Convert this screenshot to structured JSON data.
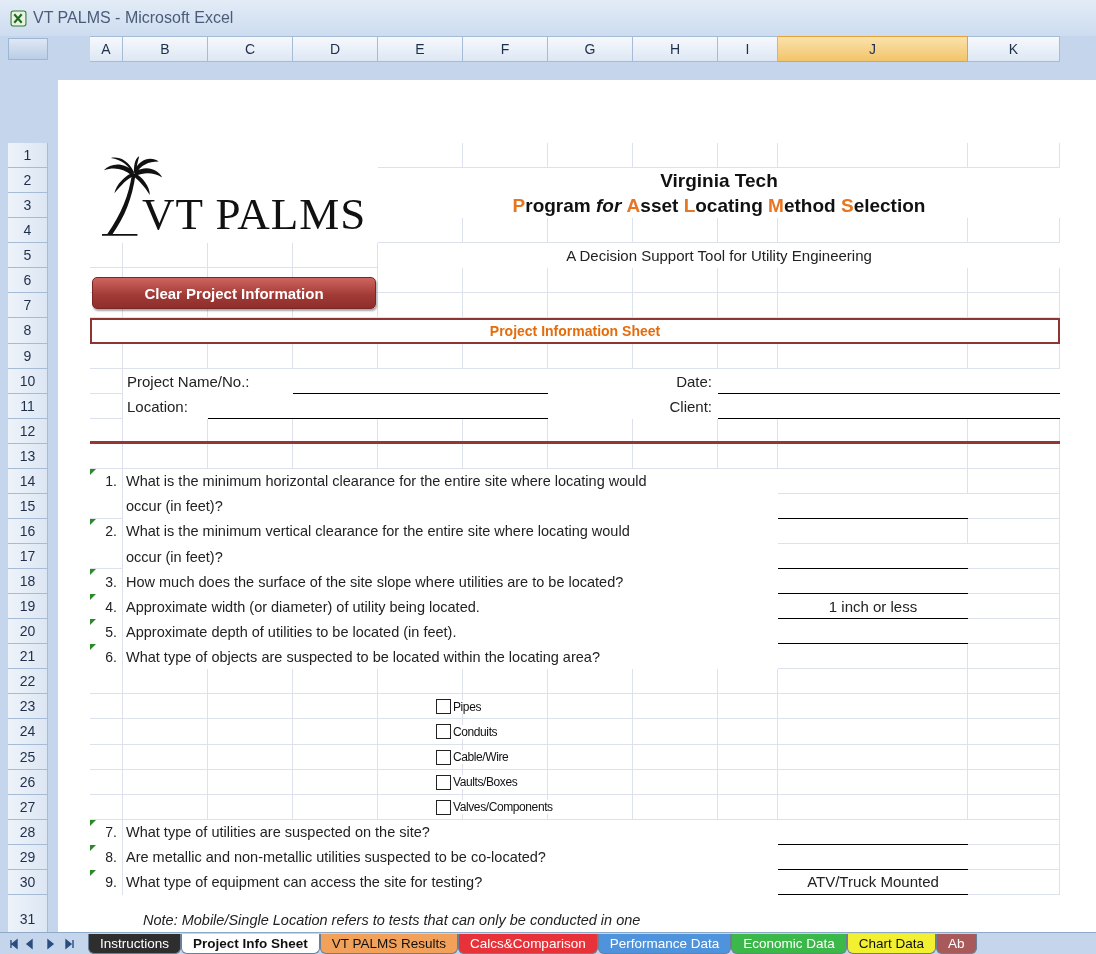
{
  "window": {
    "title": "VT PALMS - Microsoft Excel"
  },
  "columns": [
    {
      "label": "A",
      "selected": false
    },
    {
      "label": "B",
      "selected": false
    },
    {
      "label": "C",
      "selected": false
    },
    {
      "label": "D",
      "selected": false
    },
    {
      "label": "E",
      "selected": false
    },
    {
      "label": "F",
      "selected": false
    },
    {
      "label": "G",
      "selected": false
    },
    {
      "label": "H",
      "selected": false
    },
    {
      "label": "I",
      "selected": false
    },
    {
      "label": "J",
      "selected": true
    },
    {
      "label": "K",
      "selected": false
    }
  ],
  "rows": [
    "1",
    "2",
    "3",
    "4",
    "5",
    "6",
    "7",
    "8",
    "9",
    "10",
    "11",
    "12",
    "13",
    "14",
    "15",
    "16",
    "17",
    "18",
    "19",
    "20",
    "21",
    "22",
    "23",
    "24",
    "25",
    "26",
    "27",
    "28",
    "29",
    "30",
    "31"
  ],
  "logo": {
    "text": "VT PALMS"
  },
  "header": {
    "title": "Virginia Tech",
    "subtitle": [
      {
        "text": "P",
        "kind": "accent"
      },
      {
        "text": "rogram ",
        "kind": "plain"
      },
      {
        "text": "for ",
        "kind": "italic"
      },
      {
        "text": "A",
        "kind": "accent"
      },
      {
        "text": "sset ",
        "kind": "plain"
      },
      {
        "text": "L",
        "kind": "accent"
      },
      {
        "text": "ocating ",
        "kind": "plain"
      },
      {
        "text": "M",
        "kind": "accent"
      },
      {
        "text": "ethod ",
        "kind": "plain"
      },
      {
        "text": "S",
        "kind": "accent"
      },
      {
        "text": "election",
        "kind": "plain"
      }
    ],
    "tagline": "A Decision Support Tool for Utility Engineering"
  },
  "clear_button": "Clear Project Information",
  "sheet_title": "Project Information Sheet",
  "fields": [
    {
      "label": "Project Name/No.:"
    },
    {
      "label": "Date:"
    },
    {
      "label": "Location:"
    },
    {
      "label": "Client:"
    }
  ],
  "questions": [
    {
      "number": "1.",
      "lines": [
        "What is the minimum horizontal clearance for the entire site where locating would",
        "occur (in feet)?"
      ],
      "has_comment": true,
      "answer_field": true
    },
    {
      "number": "2.",
      "lines": [
        "What is the minimum vertical clearance for the entire site where locating would",
        "occur (in feet)?"
      ],
      "has_comment": true,
      "answer_field": true
    },
    {
      "number": "3.",
      "lines": [
        "How much does the surface of the site slope where utilities are to be located?"
      ],
      "has_comment": true,
      "answer_field": true
    },
    {
      "number": "4.",
      "lines": [
        "Approximate width (or diameter) of utility being located."
      ],
      "has_comment": true,
      "answer_field": true,
      "answer": "1 inch or less"
    },
    {
      "number": "5.",
      "lines": [
        "Approximate depth of utilities to be located (in feet)."
      ],
      "has_comment": true,
      "answer_field": true
    },
    {
      "number": "6.",
      "lines": [
        "What type of objects are suspected to be located within the locating area?"
      ],
      "has_comment": true,
      "answer_field": false,
      "options": [
        {
          "label": "Pipes",
          "checked": false
        },
        {
          "label": "Conduits",
          "checked": false
        },
        {
          "label": "Cable/Wire",
          "checked": false
        },
        {
          "label": "Vaults/Boxes",
          "checked": false
        },
        {
          "label": "Valves/Components",
          "checked": false
        }
      ]
    },
    {
      "number": "7.",
      "lines": [
        "What type of utilities are suspected on the site?"
      ],
      "has_comment": true,
      "answer_field": true
    },
    {
      "number": "8.",
      "lines": [
        "Are metallic and non-metallic utilities suspected to be co-located?"
      ],
      "has_comment": true,
      "answer_field": true
    },
    {
      "number": "9.",
      "lines": [
        "What type of equipment can access the site for testing?"
      ],
      "has_comment": true,
      "answer_field": true,
      "answer": "ATV/Truck Mounted",
      "note": "Note: Mobile/Single Location refers to tests that can only be conducted in one"
    }
  ],
  "sheet_tabs": [
    {
      "label": "Instructions",
      "color": "#2e2e2e",
      "selected": false
    },
    {
      "label": "Project Info Sheet",
      "color": "#ffffff",
      "selected": true
    },
    {
      "label": "VT PALMS Results",
      "color": "#f2a15a",
      "selected": false
    },
    {
      "label": "Calcs&Comparison",
      "color": "#e8323a",
      "selected": false
    },
    {
      "label": "Performance Data",
      "color": "#4f93dc",
      "selected": false
    },
    {
      "label": "Economic Data",
      "color": "#3cb84a",
      "selected": false
    },
    {
      "label": "Chart Data",
      "color": "#f2f030",
      "selected": false
    },
    {
      "label": "Ab",
      "color": "#a85a5a",
      "selected": false
    }
  ]
}
